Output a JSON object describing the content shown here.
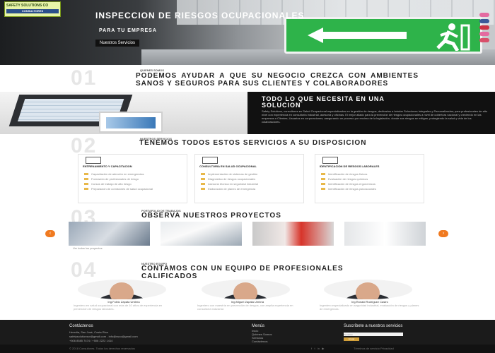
{
  "hero": {
    "logo_name": "SAFETY SOLUTIONS CO",
    "logo_tag": "CONSULTORES",
    "title": "INSPECCION DE RIESGOS OCUPACIONALES",
    "subtitle": "PARA TU EMPRESA",
    "button_label": "Nuestros Servicios",
    "exit_colors": {
      "sign": "#2eb34a"
    },
    "social_icons": [
      "instagram-icon",
      "facebook-icon",
      "youtube-icon",
      "instagram-icon",
      "pinterest-icon"
    ]
  },
  "section1": {
    "number": "01",
    "kicker": "QUIENES SOMOS",
    "title": "PODEMOS AYUDAR A QUE SU NEGOCIO CREZCA CON AMBIENTES SANOS Y SEGUROS PARA SUS CLIENTES Y COLABORADORES"
  },
  "solution": {
    "title": "TODO LO QUE NECESITA EN UNA SOLUCION",
    "text": "Safety Solutions, consultores en Salud Ocupacional especializados en la gestión de riesgos, dedicados a brindar Soluciones Integrales y Personalizadas; para profesionales de alto nivel con experiencia en consultoría industrial, asesoría y oficinas. El mejor aliado para la prevención de riesgos ocupacionales a nivel de cobertura nacional y creciendo en las empresas a Clientes, Usuarios en corporaciones; asegurando un proceso por encima de la legislación, donde sus riesgos se mitigan, protegiendo la salud y vida de los colaboradores."
  },
  "section2": {
    "number": "02",
    "kicker": "NUESTROS SERVICIOS",
    "title": "TENEMOS TODOS ESTOS SERVICIOS A SU DISPOSICION",
    "services": [
      {
        "icon": "gears-icon",
        "title": "ENTRENAMIENTO Y CAPACITACION",
        "items": [
          "Capacitación de atención en emergencias",
          "Formación de profesionales de riesgo",
          "Cursos de trabajo de alto riesgo",
          "Preparación de comisiones de salud ocupacional"
        ]
      },
      {
        "icon": "monitor-icon",
        "title": "CONSULTORIA EN SALUD OCUPACIONAL",
        "items": [
          "Implementación de sistemas de gestión",
          "Diagnóstico de riesgos ocupacionales",
          "Asesoría técnica en seguridad industrial",
          "Elaboración de planes de emergencia"
        ]
      },
      {
        "icon": "bar-chart-icon",
        "title": "IDENTIFICACION DE RIESGOS LABORALES",
        "items": [
          "Identificación de riesgos físicos",
          "Evaluación de riesgos químicos",
          "Identificación de riesgos ergonómicos",
          "Identificación de riesgos psicosociales"
        ]
      }
    ]
  },
  "section3": {
    "number": "03",
    "kicker": "PORTAFOLIO DE TRABAJOS",
    "title": "OBSERVA NUESTROS PROYECTOS",
    "caption": "Ver todos los proyectos",
    "prev": "‹",
    "next": "›"
  },
  "section4": {
    "number": "04",
    "kicker": "NUESTRO EQUIPO",
    "title": "CONTAMOS CON UN EQUIPO DE PROFESIONALES CALIFICADOS",
    "team": [
      {
        "name": "Ing.Fulvio Zapata Umbría",
        "desc": "Ingeniero en salud ocupacional con más de 10 años de experiencia en prevención de riesgos laborales."
      },
      {
        "name": "Ing.Miguel Zapata Umbría",
        "desc": "Ingeniero con maestría en prevención de riesgos, con amplia experiencia en consultoría industrial."
      },
      {
        "name": "Ing.Ronald Rodríguez Castro",
        "desc": "Ingeniero especializado en seguridad industrial, evaluación de riesgos y planes de emergencia."
      }
    ]
  },
  "footer": {
    "contact_title": "Contáctenos",
    "address": "Heredia, San José, Costa Rica",
    "email": "safetysolutionscr@gmail.com - info@ssco@gmail.com",
    "phone": "+506 8585 7474 / +506 2222 1414",
    "menu_title": "Menús",
    "menu": [
      "Inicio",
      "Quiénes Somos",
      "Servicios",
      "Contáctenos"
    ],
    "subscribe_title": "Suscríbete a nuestros servicios",
    "subscribe_placeholder": "Tu correo",
    "subscribe_button": "Enviar",
    "copyright": "© 2018 Consultores. Todos los derechos reservados",
    "legal": "Términos de servicio   Privacidad"
  }
}
